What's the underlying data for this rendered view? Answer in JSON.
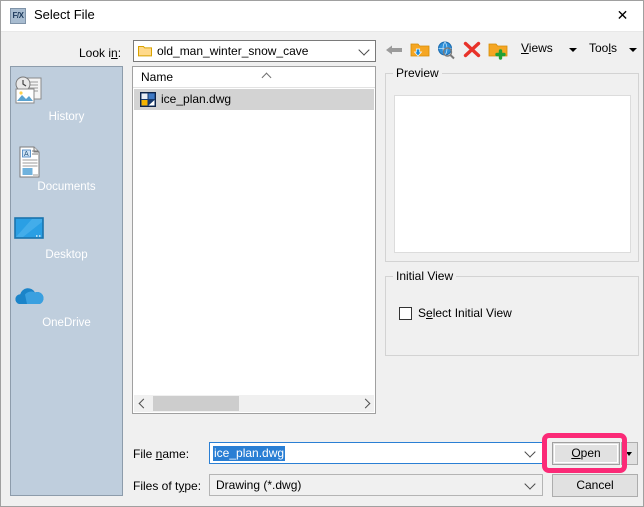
{
  "window": {
    "title": "Select File",
    "app_icon": "F/X",
    "close_label": "✕"
  },
  "lookin": {
    "label": "Look in:",
    "value": "old_man_winter_snow_cave",
    "folder_icon": "folder-icon",
    "chevron_icon": "chevron-down-icon"
  },
  "toolbar": {
    "back_icon": "back-arrow-icon",
    "up_folder_icon": "up-one-level-folder-icon",
    "search_web_icon": "search-web-globe-icon",
    "delete_icon": "delete-x-icon",
    "new_folder_icon": "new-folder-icon",
    "views_label": "Views",
    "views_arrow_icon": "chevron-down-icon",
    "tools_label": "Tools",
    "tools_arrow_icon": "chevron-down-icon"
  },
  "places": [
    {
      "label": "History",
      "icon": "history-icon"
    },
    {
      "label": "Documents",
      "icon": "documents-icon"
    },
    {
      "label": "Desktop",
      "icon": "desktop-icon"
    },
    {
      "label": "OneDrive",
      "icon": "onedrive-cloud-icon"
    }
  ],
  "filelist": {
    "column_header": "Name",
    "sort_indicator": "sort-ascending-icon",
    "files": [
      {
        "name": "ice_plan.dwg",
        "icon": "dwg-file-icon",
        "selected": true
      }
    ],
    "scrollbar": {
      "left_arrow_icon": "chevron-left-icon",
      "right_arrow_icon": "chevron-right-icon"
    }
  },
  "preview": {
    "title": "Preview",
    "content": ""
  },
  "initial_view": {
    "title": "Initial View",
    "checkbox_label": "Select Initial View",
    "checked": false
  },
  "form": {
    "filename_label": "File name:",
    "filename_value": "ice_plan.dwg",
    "filetype_label": "Files of type:",
    "filetype_value": "Drawing (*.dwg)",
    "open_label": "Open",
    "open_split_icon": "chevron-down-icon",
    "cancel_label": "Cancel"
  },
  "annotation": {
    "highlight_color": "#fb2a77",
    "target": "open-button"
  }
}
